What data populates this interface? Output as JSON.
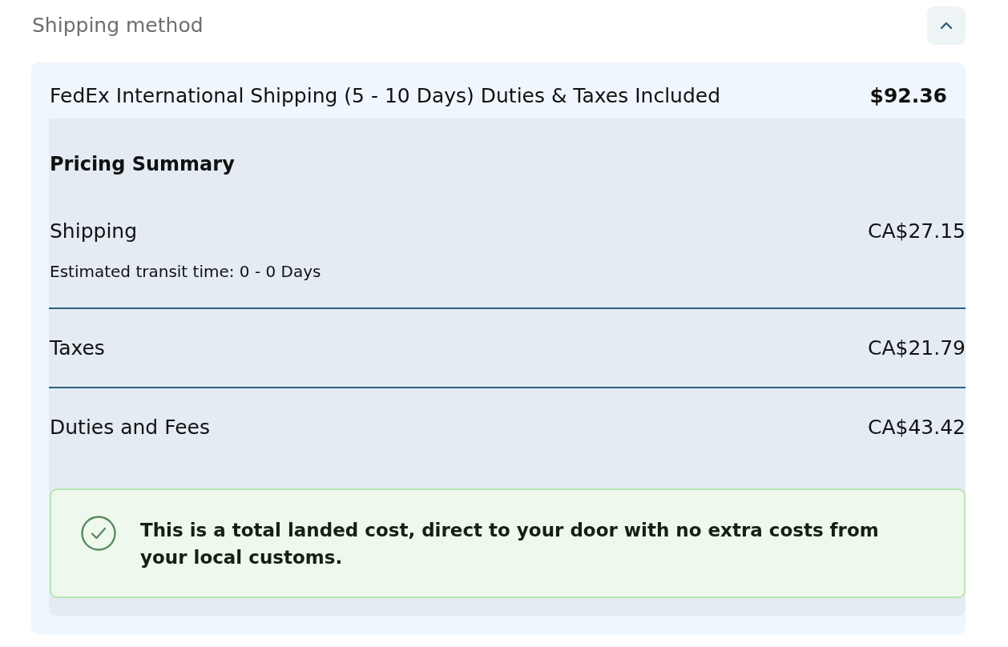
{
  "section": {
    "title": "Shipping method",
    "expanded": true
  },
  "shipping_option": {
    "name": "FedEx International Shipping (5 - 10 Days) Duties & Taxes Included",
    "price": "$92.36"
  },
  "pricing_summary": {
    "title": "Pricing Summary",
    "lines": [
      {
        "label": "Shipping",
        "amount": "CA$27.15",
        "note": "Estimated transit time: 0 - 0 Days"
      },
      {
        "label": "Taxes",
        "amount": "CA$21.79"
      },
      {
        "label": "Duties and Fees",
        "amount": "CA$43.42"
      }
    ]
  },
  "notice": {
    "text": "This is a total landed cost, direct to your door with no extra costs from your local customs."
  }
}
